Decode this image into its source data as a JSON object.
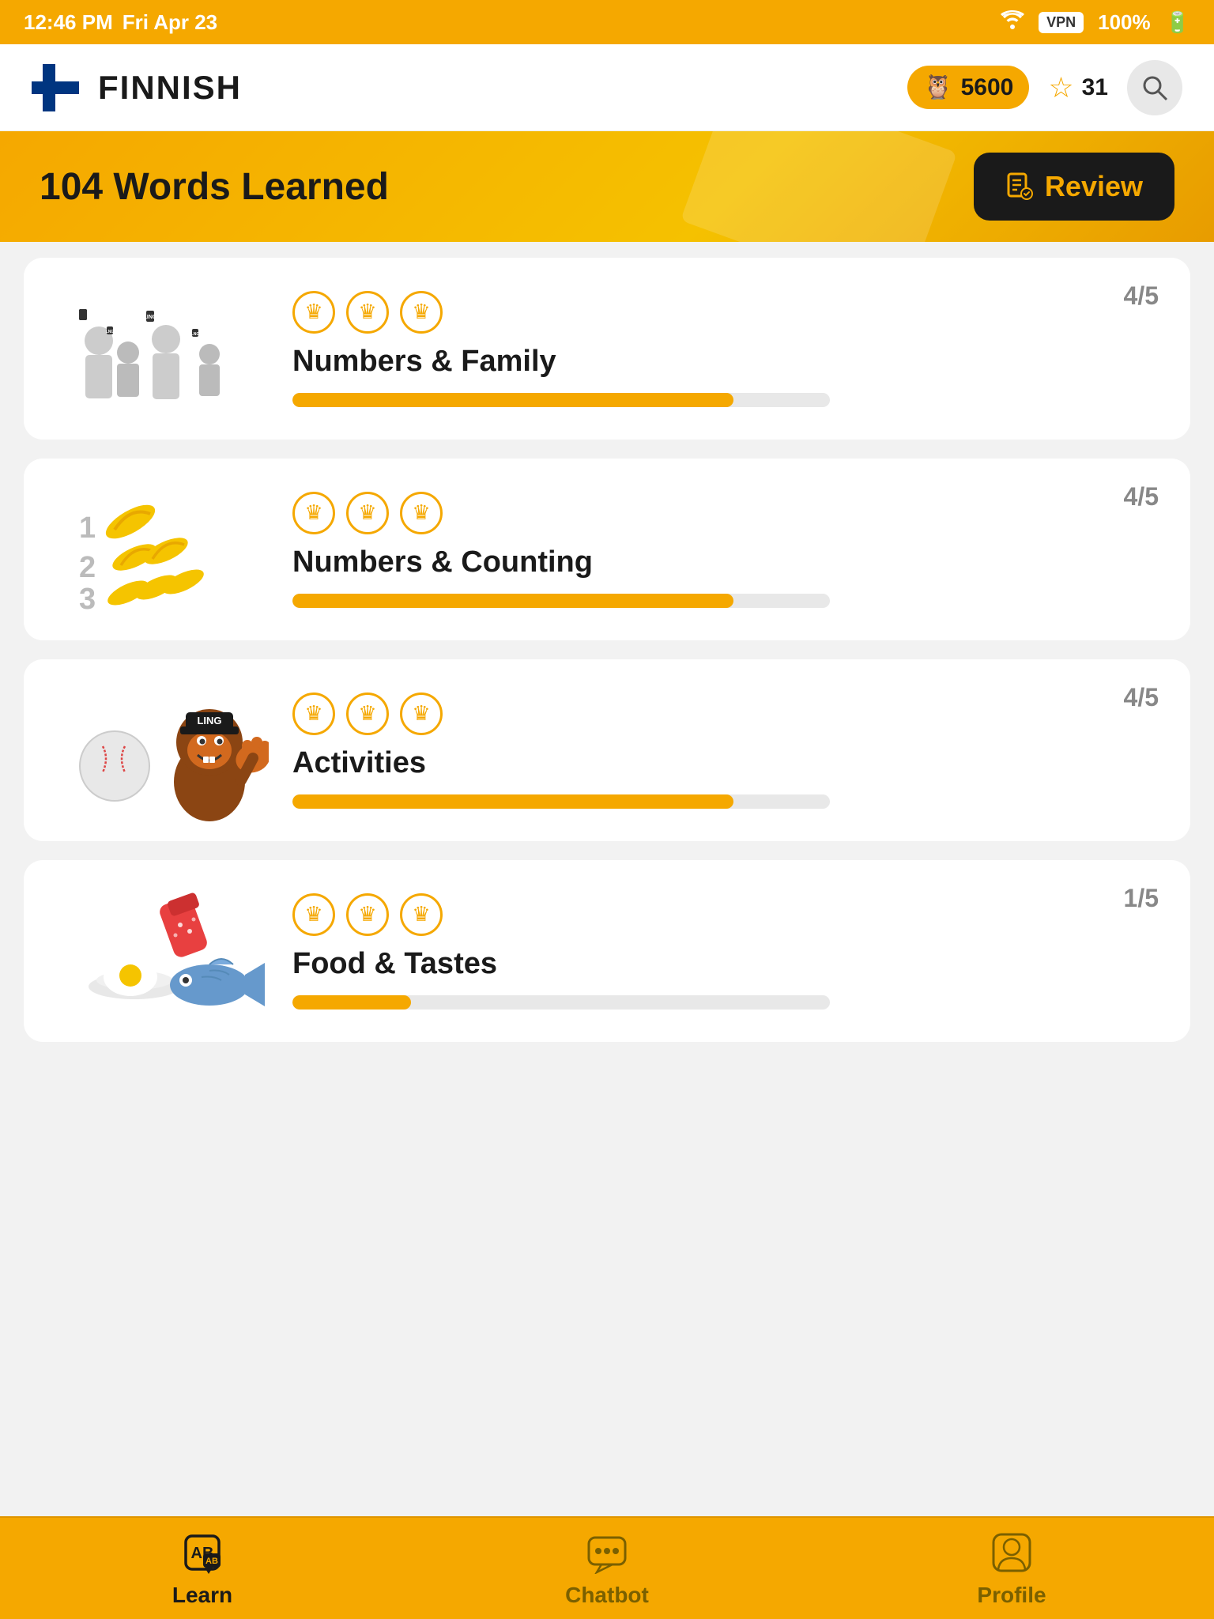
{
  "statusBar": {
    "time": "12:46 PM",
    "date": "Fri Apr 23",
    "battery": "100%"
  },
  "header": {
    "language": "FINNISH",
    "coins": "5600",
    "streak": "31",
    "searchLabel": "search"
  },
  "banner": {
    "title": "104 Words Learned",
    "reviewButton": "Review"
  },
  "lessons": [
    {
      "title": "Numbers & Family",
      "score": "4/5",
      "progress": 82,
      "crowns": 3
    },
    {
      "title": "Numbers & Counting",
      "score": "4/5",
      "progress": 82,
      "crowns": 3
    },
    {
      "title": "Activities",
      "score": "4/5",
      "progress": 82,
      "crowns": 3
    },
    {
      "title": "Food & Tastes",
      "score": "1/5",
      "progress": 22,
      "crowns": 3
    }
  ],
  "bottomNav": {
    "learn": "Learn",
    "chatbot": "Chatbot",
    "profile": "Profile"
  },
  "colors": {
    "accent": "#f5a800",
    "dark": "#1a1a1a",
    "gray": "#888888"
  }
}
